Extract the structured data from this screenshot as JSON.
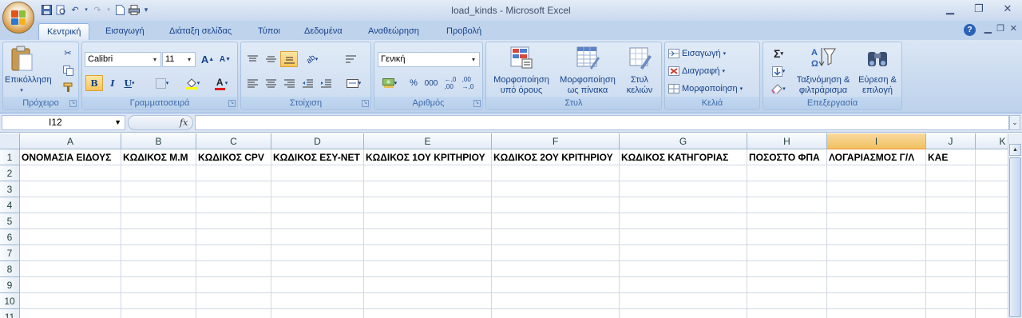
{
  "window": {
    "title": "load_kinds - Microsoft Excel"
  },
  "tabs": [
    "Κεντρική",
    "Εισαγωγή",
    "Διάταξη σελίδας",
    "Τύποι",
    "Δεδομένα",
    "Αναθεώρηση",
    "Προβολή"
  ],
  "ribbon": {
    "clipboard": {
      "label": "Πρόχειρο",
      "paste": "Επικόλληση"
    },
    "font": {
      "label": "Γραμματοσειρά",
      "name": "Calibri",
      "size": "11",
      "bold": "B",
      "italic": "I",
      "underline": "U"
    },
    "alignment": {
      "label": "Στοίχιση"
    },
    "number": {
      "label": "Αριθμός",
      "format": "Γενική",
      "percent": "%",
      "thousands": "000"
    },
    "styles": {
      "label": "Στυλ",
      "conditional": "Μορφοποίηση υπό όρους",
      "as_table": "Μορφοποίηση ως πίνακα",
      "cell_styles": "Στυλ κελιών"
    },
    "cells": {
      "label": "Κελιά",
      "insert": "Εισαγωγή",
      "delete": "Διαγραφή",
      "format": "Μορφοποίηση"
    },
    "editing": {
      "label": "Επεξεργασία",
      "sort": "Ταξινόμηση & φιλτράρισμα",
      "find": "Εύρεση & επιλογή",
      "sum": "Σ"
    }
  },
  "formula_bar": {
    "name_box": "I12",
    "fx": "fx",
    "formula": ""
  },
  "grid": {
    "columns": [
      "A",
      "B",
      "C",
      "D",
      "E",
      "F",
      "G",
      "H",
      "I",
      "J",
      "K"
    ],
    "selected_column": "I",
    "rows": [
      "1",
      "2",
      "3",
      "4",
      "5",
      "6",
      "7",
      "8",
      "9",
      "10",
      "11"
    ],
    "row1": [
      "ΟΝΟΜΑΣΙΑ ΕΙΔΟΥΣ",
      "ΚΩΔΙΚΟΣ Μ.Μ",
      "ΚΩΔΙΚΟΣ CPV",
      "ΚΩΔΙΚΟΣ ΕΣΥ-ΝΕΤ",
      "ΚΩΔΙΚΟΣ 1ΟΥ ΚΡΙΤΗΡΙΟΥ",
      "ΚΩΔΙΚΟΣ 2ΟΥ ΚΡΙΤΗΡΙΟΥ",
      "ΚΩΔΙΚΟΣ ΚΑΤΗΓΟΡΙΑΣ",
      "ΠΟΣΟΣΤΟ ΦΠΑ",
      "ΛΟΓΑΡΙΑΣΜΟΣ Γ/Λ",
      "ΚΑΕ",
      ""
    ]
  }
}
